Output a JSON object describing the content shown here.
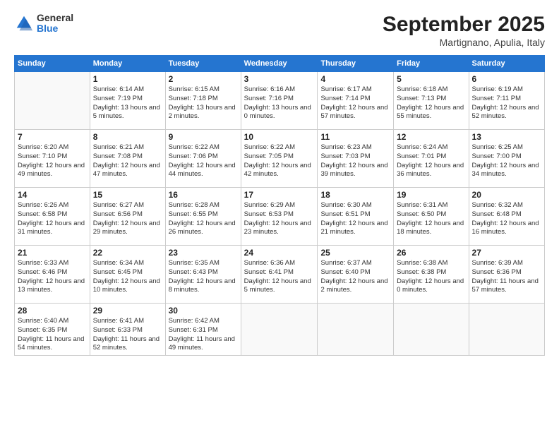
{
  "header": {
    "logo_general": "General",
    "logo_blue": "Blue",
    "month": "September 2025",
    "location": "Martignano, Apulia, Italy"
  },
  "weekdays": [
    "Sunday",
    "Monday",
    "Tuesday",
    "Wednesday",
    "Thursday",
    "Friday",
    "Saturday"
  ],
  "weeks": [
    [
      {
        "day": "",
        "info": ""
      },
      {
        "day": "1",
        "info": "Sunrise: 6:14 AM\nSunset: 7:19 PM\nDaylight: 13 hours\nand 5 minutes."
      },
      {
        "day": "2",
        "info": "Sunrise: 6:15 AM\nSunset: 7:18 PM\nDaylight: 13 hours\nand 2 minutes."
      },
      {
        "day": "3",
        "info": "Sunrise: 6:16 AM\nSunset: 7:16 PM\nDaylight: 13 hours\nand 0 minutes."
      },
      {
        "day": "4",
        "info": "Sunrise: 6:17 AM\nSunset: 7:14 PM\nDaylight: 12 hours\nand 57 minutes."
      },
      {
        "day": "5",
        "info": "Sunrise: 6:18 AM\nSunset: 7:13 PM\nDaylight: 12 hours\nand 55 minutes."
      },
      {
        "day": "6",
        "info": "Sunrise: 6:19 AM\nSunset: 7:11 PM\nDaylight: 12 hours\nand 52 minutes."
      }
    ],
    [
      {
        "day": "7",
        "info": "Sunrise: 6:20 AM\nSunset: 7:10 PM\nDaylight: 12 hours\nand 49 minutes."
      },
      {
        "day": "8",
        "info": "Sunrise: 6:21 AM\nSunset: 7:08 PM\nDaylight: 12 hours\nand 47 minutes."
      },
      {
        "day": "9",
        "info": "Sunrise: 6:22 AM\nSunset: 7:06 PM\nDaylight: 12 hours\nand 44 minutes."
      },
      {
        "day": "10",
        "info": "Sunrise: 6:22 AM\nSunset: 7:05 PM\nDaylight: 12 hours\nand 42 minutes."
      },
      {
        "day": "11",
        "info": "Sunrise: 6:23 AM\nSunset: 7:03 PM\nDaylight: 12 hours\nand 39 minutes."
      },
      {
        "day": "12",
        "info": "Sunrise: 6:24 AM\nSunset: 7:01 PM\nDaylight: 12 hours\nand 36 minutes."
      },
      {
        "day": "13",
        "info": "Sunrise: 6:25 AM\nSunset: 7:00 PM\nDaylight: 12 hours\nand 34 minutes."
      }
    ],
    [
      {
        "day": "14",
        "info": "Sunrise: 6:26 AM\nSunset: 6:58 PM\nDaylight: 12 hours\nand 31 minutes."
      },
      {
        "day": "15",
        "info": "Sunrise: 6:27 AM\nSunset: 6:56 PM\nDaylight: 12 hours\nand 29 minutes."
      },
      {
        "day": "16",
        "info": "Sunrise: 6:28 AM\nSunset: 6:55 PM\nDaylight: 12 hours\nand 26 minutes."
      },
      {
        "day": "17",
        "info": "Sunrise: 6:29 AM\nSunset: 6:53 PM\nDaylight: 12 hours\nand 23 minutes."
      },
      {
        "day": "18",
        "info": "Sunrise: 6:30 AM\nSunset: 6:51 PM\nDaylight: 12 hours\nand 21 minutes."
      },
      {
        "day": "19",
        "info": "Sunrise: 6:31 AM\nSunset: 6:50 PM\nDaylight: 12 hours\nand 18 minutes."
      },
      {
        "day": "20",
        "info": "Sunrise: 6:32 AM\nSunset: 6:48 PM\nDaylight: 12 hours\nand 16 minutes."
      }
    ],
    [
      {
        "day": "21",
        "info": "Sunrise: 6:33 AM\nSunset: 6:46 PM\nDaylight: 12 hours\nand 13 minutes."
      },
      {
        "day": "22",
        "info": "Sunrise: 6:34 AM\nSunset: 6:45 PM\nDaylight: 12 hours\nand 10 minutes."
      },
      {
        "day": "23",
        "info": "Sunrise: 6:35 AM\nSunset: 6:43 PM\nDaylight: 12 hours\nand 8 minutes."
      },
      {
        "day": "24",
        "info": "Sunrise: 6:36 AM\nSunset: 6:41 PM\nDaylight: 12 hours\nand 5 minutes."
      },
      {
        "day": "25",
        "info": "Sunrise: 6:37 AM\nSunset: 6:40 PM\nDaylight: 12 hours\nand 2 minutes."
      },
      {
        "day": "26",
        "info": "Sunrise: 6:38 AM\nSunset: 6:38 PM\nDaylight: 12 hours\nand 0 minutes."
      },
      {
        "day": "27",
        "info": "Sunrise: 6:39 AM\nSunset: 6:36 PM\nDaylight: 11 hours\nand 57 minutes."
      }
    ],
    [
      {
        "day": "28",
        "info": "Sunrise: 6:40 AM\nSunset: 6:35 PM\nDaylight: 11 hours\nand 54 minutes."
      },
      {
        "day": "29",
        "info": "Sunrise: 6:41 AM\nSunset: 6:33 PM\nDaylight: 11 hours\nand 52 minutes."
      },
      {
        "day": "30",
        "info": "Sunrise: 6:42 AM\nSunset: 6:31 PM\nDaylight: 11 hours\nand 49 minutes."
      },
      {
        "day": "",
        "info": ""
      },
      {
        "day": "",
        "info": ""
      },
      {
        "day": "",
        "info": ""
      },
      {
        "day": "",
        "info": ""
      }
    ]
  ]
}
